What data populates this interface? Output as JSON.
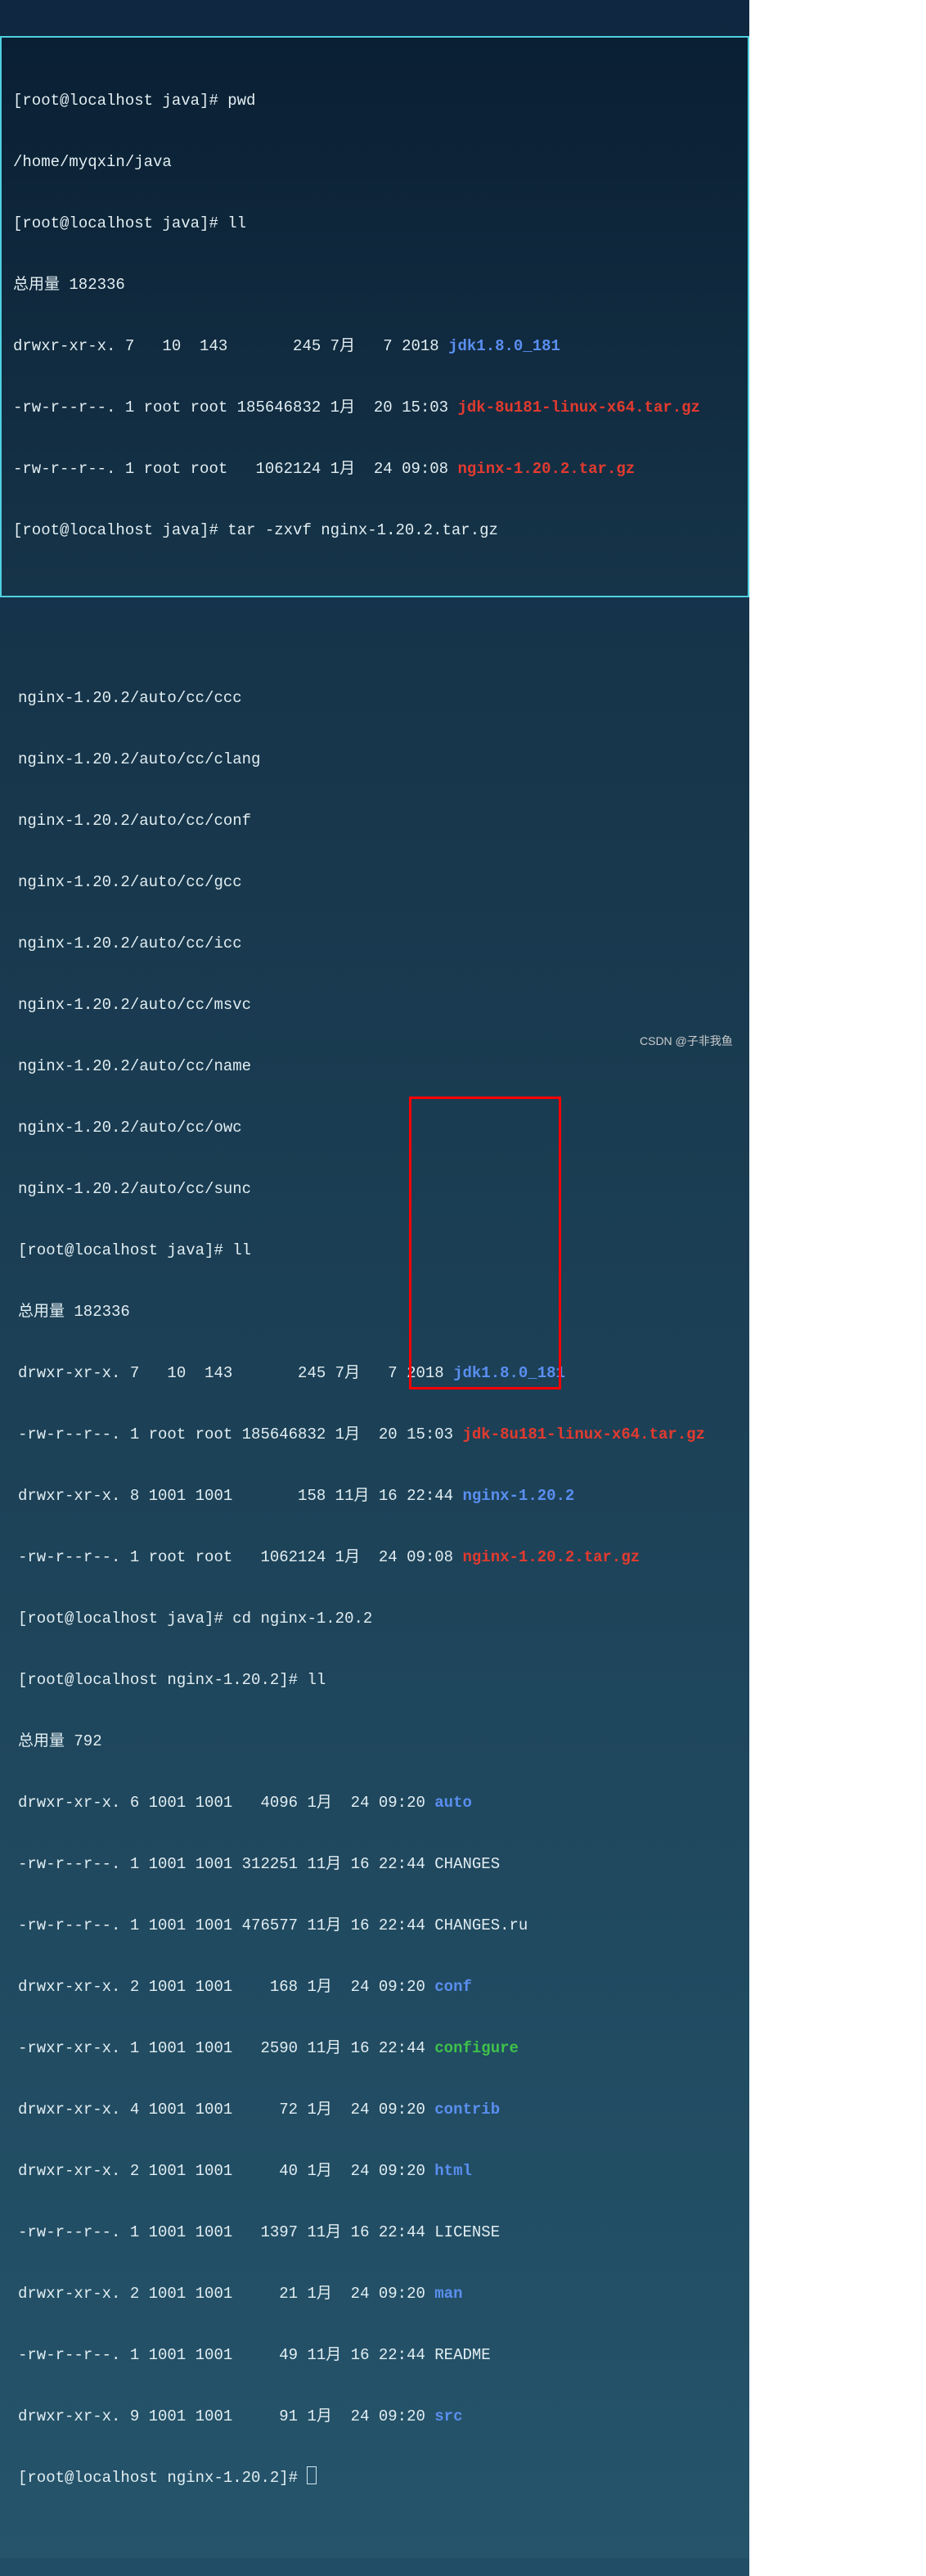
{
  "b1": {
    "p1": "[root@localhost java]# pwd",
    "pwd": "/home/myqxin/java",
    "p2": "[root@localhost java]# ll",
    "tot": "总用量 182336",
    "r1a": "drwxr-xr-x. 7   10  143       245 7月   7 2018 ",
    "r1b": "jdk1.8.0_181",
    "r2a": "-rw-r--r--. 1 root root 185646832 1月  20 15:03 ",
    "r2b": "jdk-8u181-linux-x64.tar.gz",
    "r3a": "-rw-r--r--. 1 root root   1062124 1月  24 09:08 ",
    "r3b": "nginx-1.20.2.tar.gz",
    "p3": "[root@localhost java]# tar -zxvf nginx-1.20.2.tar.gz"
  },
  "b2": {
    "u1": "nginx-1.20.2/auto/cc/ccc",
    "u2": "nginx-1.20.2/auto/cc/clang",
    "u3": "nginx-1.20.2/auto/cc/conf",
    "u4": "nginx-1.20.2/auto/cc/gcc",
    "u5": "nginx-1.20.2/auto/cc/icc",
    "u6": "nginx-1.20.2/auto/cc/msvc",
    "u7": "nginx-1.20.2/auto/cc/name",
    "u8": "nginx-1.20.2/auto/cc/owc",
    "u9": "nginx-1.20.2/auto/cc/sunc",
    "p1": "[root@localhost java]# ll",
    "tot1": "总用量 182336",
    "l1a": "drwxr-xr-x. 7   10  143       245 7月   7 2018 ",
    "l1b": "jdk1.8.0_181",
    "l2a": "-rw-r--r--. 1 root root 185646832 1月  20 15:03 ",
    "l2b": "jdk-8u181-linux-x64.tar.gz",
    "l3a": "drwxr-xr-x. 8 1001 1001       158 11月 16 22:44 ",
    "l3b": "nginx-1.20.2",
    "l4a": "-rw-r--r--. 1 root root   1062124 1月  24 09:08 ",
    "l4b": "nginx-1.20.2.tar.gz",
    "p2": "[root@localhost java]# cd nginx-1.20.2",
    "p3": "[root@localhost nginx-1.20.2]# ll",
    "tot2": "总用量 792",
    "n1a": "drwxr-xr-x. 6 1001 1001   4096 1月  24 09:20 ",
    "n1b": "auto",
    "n2": "-rw-r--r--. 1 1001 1001 312251 11月 16 22:44 CHANGES",
    "n3": "-rw-r--r--. 1 1001 1001 476577 11月 16 22:44 CHANGES.ru",
    "n4a": "drwxr-xr-x. 2 1001 1001    168 1月  24 09:20 ",
    "n4b": "conf",
    "n5a": "-rwxr-xr-x. 1 1001 1001   2590 11月 16 22:44 ",
    "n5b": "configure",
    "n6a": "drwxr-xr-x. 4 1001 1001     72 1月  24 09:20 ",
    "n6b": "contrib",
    "n7a": "drwxr-xr-x. 2 1001 1001     40 1月  24 09:20 ",
    "n7b": "html",
    "n8": "-rw-r--r--. 1 1001 1001   1397 11月 16 22:44 LICENSE",
    "n9a": "drwxr-xr-x. 2 1001 1001     21 1月  24 09:20 ",
    "n9b": "man",
    "n10": "-rw-r--r--. 1 1001 1001     49 11月 16 22:44 README",
    "n11a": "drwxr-xr-x. 9 1001 1001     91 1月  24 09:20 ",
    "n11b": "src",
    "p4": "[root@localhost nginx-1.20.2]# "
  },
  "watermark": "CSDN @子非我鱼"
}
